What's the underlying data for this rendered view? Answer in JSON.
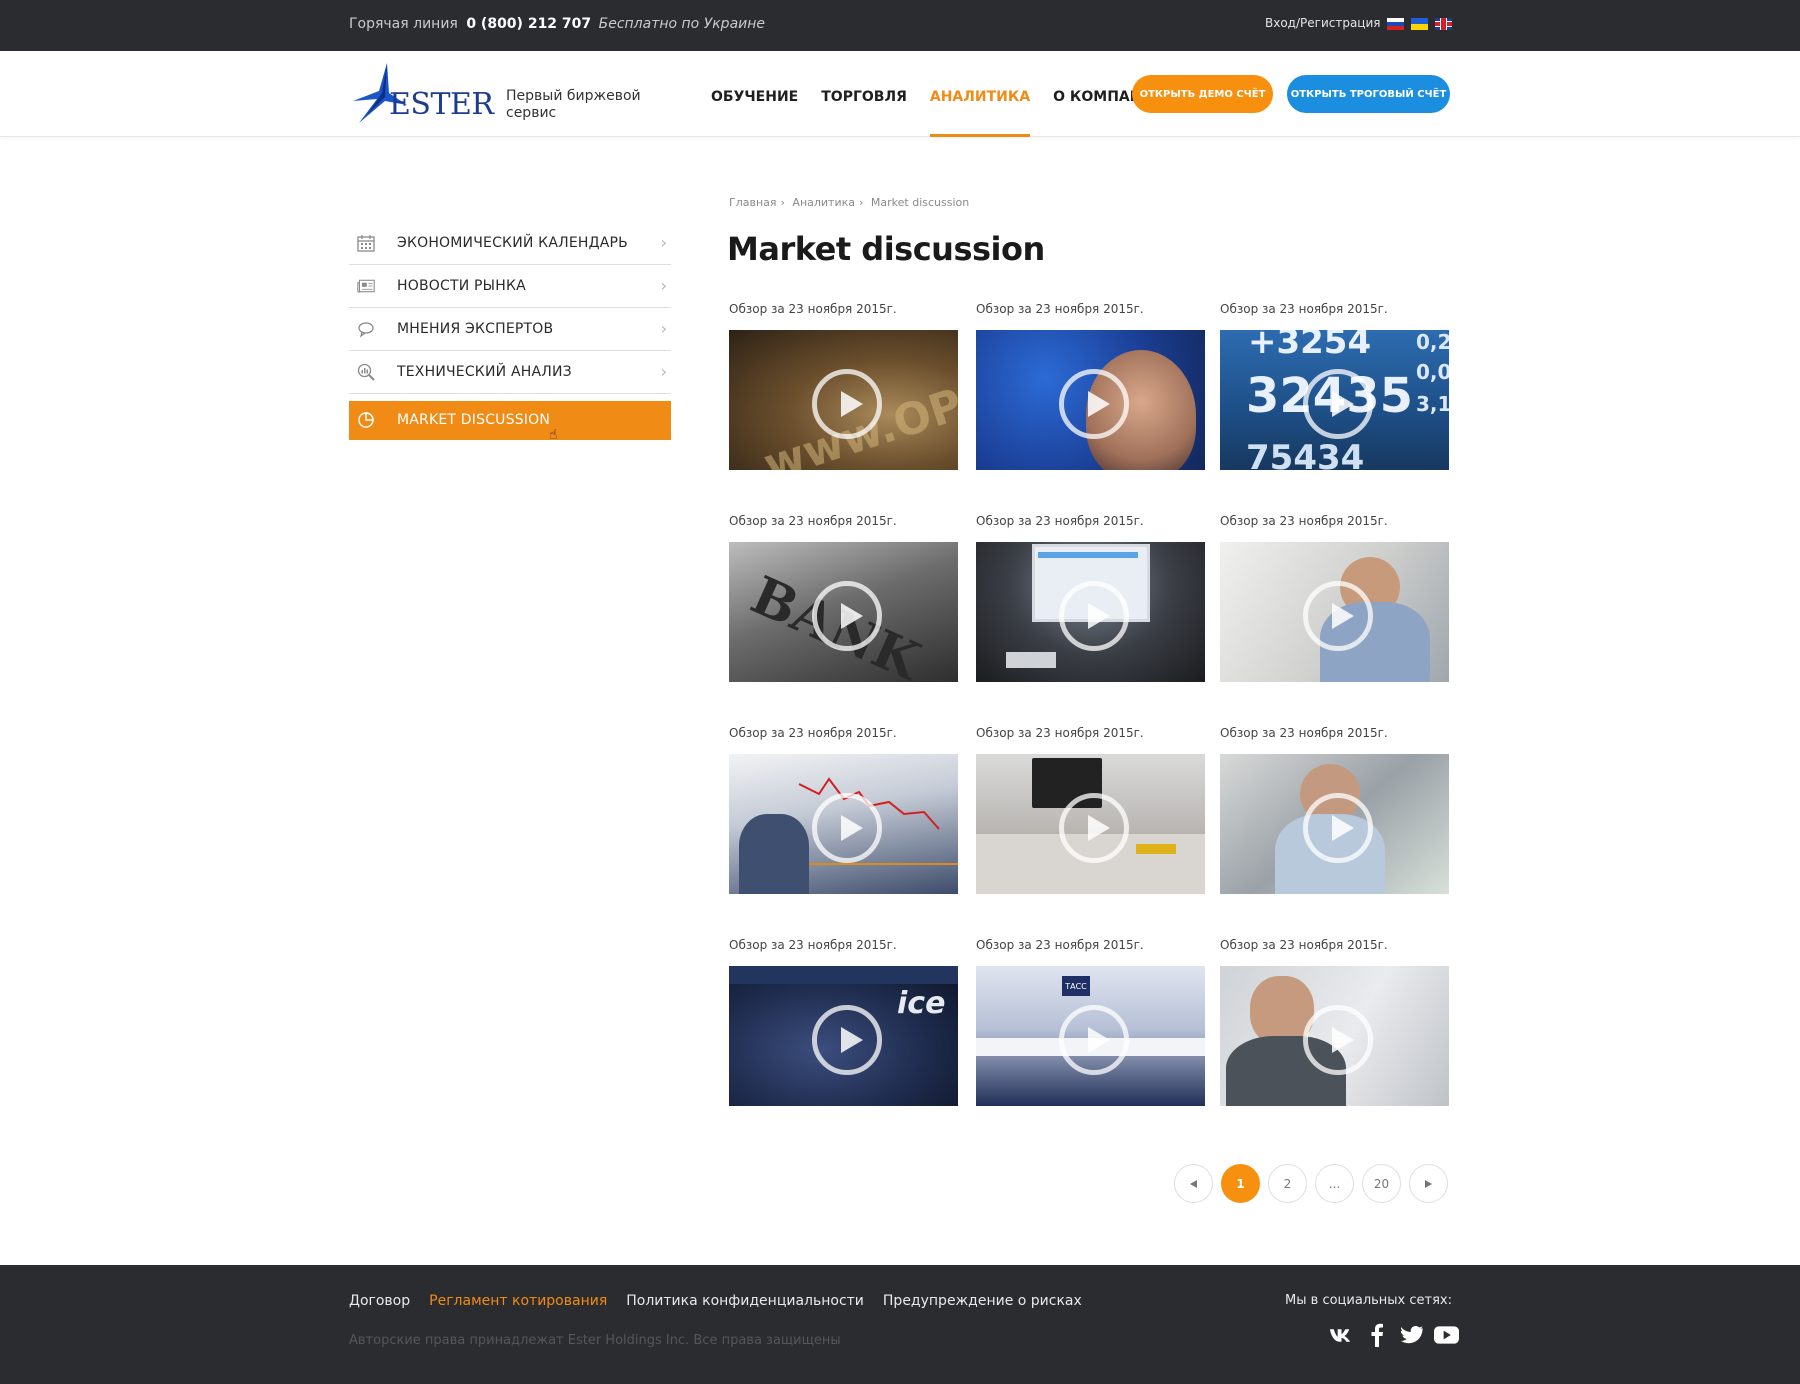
{
  "topbar": {
    "hotline_label": "Горячая линия",
    "phone": "0 (800) 212 707",
    "free_note": "Бесплатно по Украине",
    "login": "Вход/Регистрация",
    "languages": [
      "ru",
      "ua",
      "en"
    ]
  },
  "header": {
    "logo_text": "ESTER",
    "tagline": "Первый биржевой сервис",
    "nav": [
      {
        "label": "ОБУЧЕНИЕ",
        "active": false
      },
      {
        "label": "ТОРГОВЛЯ",
        "active": false
      },
      {
        "label": "АНАЛИТИКА",
        "active": true
      },
      {
        "label": "О КОМПАНИИ",
        "active": false
      }
    ],
    "demo_button": "Открыть демо счёт",
    "real_button": "Открыть троговый счёт"
  },
  "sidebar": {
    "items": [
      {
        "label": "ЭКОНОМИЧЕСКИЙ КАЛЕНДАРЬ",
        "icon": "calendar-icon"
      },
      {
        "label": "НОВОСТИ РЫНКА",
        "icon": "newspaper-icon"
      },
      {
        "label": "МНЕНИЯ ЭКСПЕРТОВ",
        "icon": "speech-bubble-icon"
      },
      {
        "label": "ТЕХНИЧЕСКИЙ АНАЛИЗ",
        "icon": "magnifier-chart-icon"
      },
      {
        "label": "MARKET DISCUSSION",
        "icon": "pie-chart-icon",
        "active": true
      }
    ]
  },
  "breadcrumb": {
    "items": [
      "Главная",
      "Аналитика",
      "Market discussion"
    ],
    "separator": "›"
  },
  "main": {
    "title": "Market discussion",
    "videos": [
      {
        "date": "Обзор за 23 ноября 2015г."
      },
      {
        "date": "Обзор за 23 ноября 2015г."
      },
      {
        "date": "Обзор за 23 ноября 2015г."
      },
      {
        "date": "Обзор за 23 ноября 2015г."
      },
      {
        "date": "Обзор за 23 ноября 2015г."
      },
      {
        "date": "Обзор за 23 ноября 2015г."
      },
      {
        "date": "Обзор за 23 ноября 2015г."
      },
      {
        "date": "Обзор за 23 ноября 2015г."
      },
      {
        "date": "Обзор за 23 ноября 2015г."
      },
      {
        "date": "Обзор за 23 ноября 2015г."
      },
      {
        "date": "Обзор за 23 ноября 2015г."
      },
      {
        "date": "Обзор за 23 ноября 2015г."
      }
    ]
  },
  "pagination": {
    "pages": [
      "1",
      "2",
      "...",
      "20"
    ],
    "current": "1"
  },
  "footer": {
    "links": [
      {
        "label": "Договор",
        "highlight": false
      },
      {
        "label": "Регламент котирования",
        "highlight": true
      },
      {
        "label": "Политика конфиденциальности",
        "highlight": false
      },
      {
        "label": "Предупреждение о рисках",
        "highlight": false
      }
    ],
    "copyright": "Авторские права принадлежат  Ester Holdings Inc. Все права защищены",
    "social_title": "Мы в социальных сетях:",
    "social": [
      "vk-icon",
      "facebook-icon",
      "twitter-icon",
      "youtube-icon"
    ]
  },
  "colors": {
    "accent": "#f08c16",
    "blue": "#1b8ee0",
    "dark": "#2b2c30"
  }
}
